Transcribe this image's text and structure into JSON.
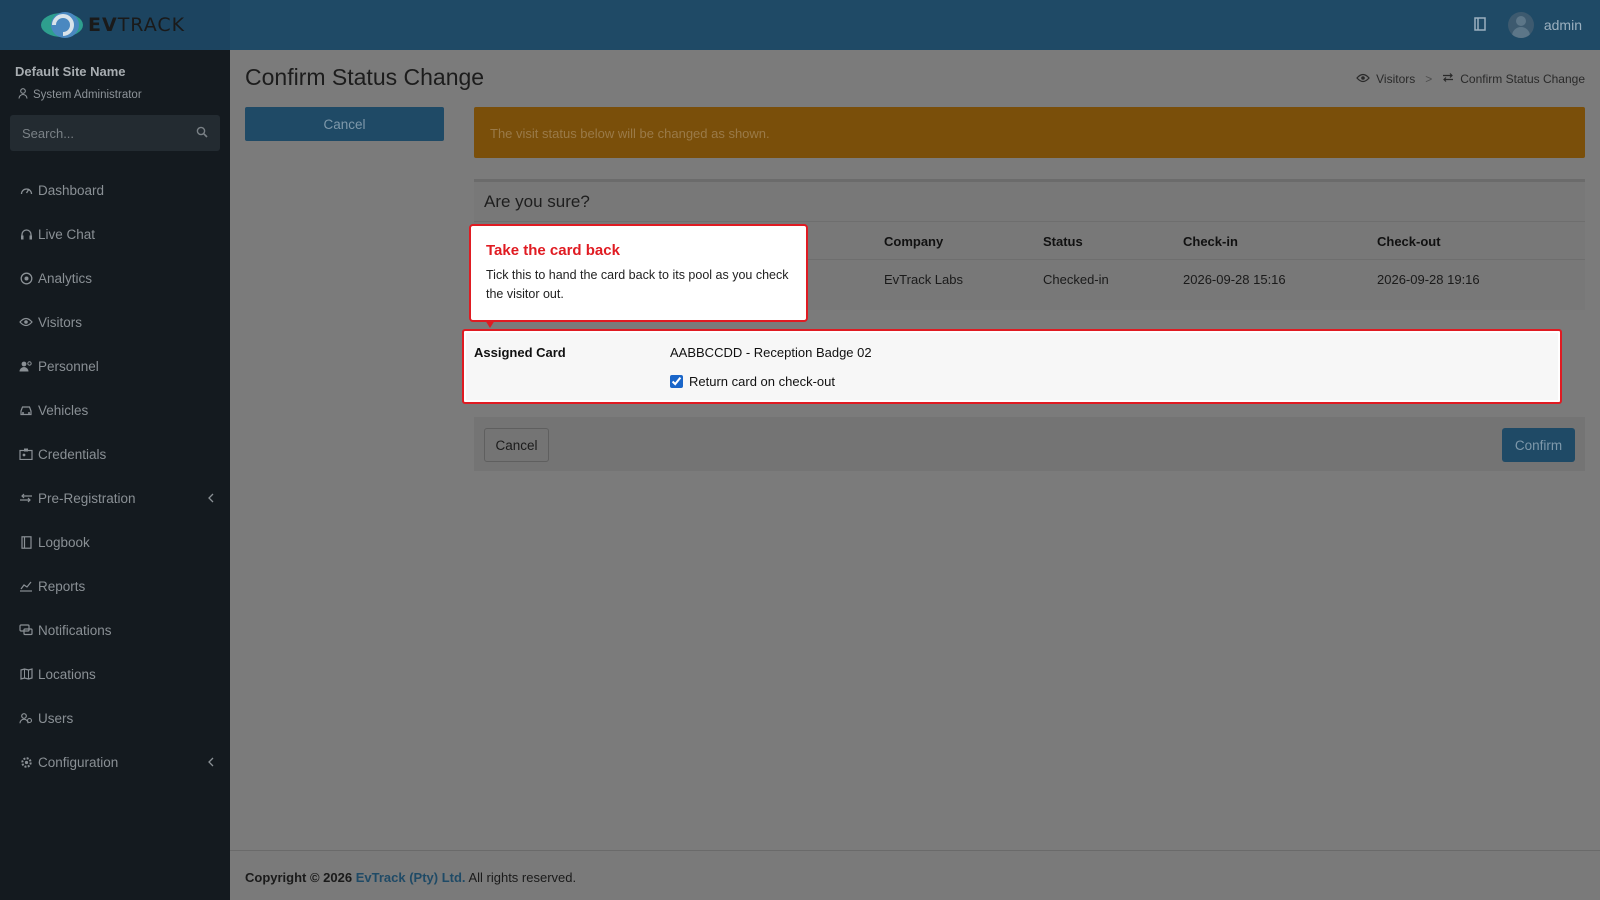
{
  "brand": {
    "name_bold": "EV",
    "name_rest": "TRACK"
  },
  "topbar": {
    "user_name": "admin"
  },
  "sidebar": {
    "site_name": "Default Site Name",
    "role": "System Administrator",
    "search_placeholder": "Search...",
    "items": [
      {
        "label": "Dashboard",
        "icon": "gauge-icon"
      },
      {
        "label": "Live Chat",
        "icon": "headset-icon"
      },
      {
        "label": "Analytics",
        "icon": "target-icon"
      },
      {
        "label": "Visitors",
        "icon": "eye-icon"
      },
      {
        "label": "Personnel",
        "icon": "user-group-icon"
      },
      {
        "label": "Vehicles",
        "icon": "car-icon"
      },
      {
        "label": "Credentials",
        "icon": "id-card-icon"
      },
      {
        "label": "Pre-Registration",
        "icon": "arrows-icon",
        "has_children": true
      },
      {
        "label": "Logbook",
        "icon": "book-icon"
      },
      {
        "label": "Reports",
        "icon": "chart-icon"
      },
      {
        "label": "Notifications",
        "icon": "chat-icon"
      },
      {
        "label": "Locations",
        "icon": "map-icon"
      },
      {
        "label": "Users",
        "icon": "users-icon"
      },
      {
        "label": "Configuration",
        "icon": "gear-icon",
        "has_children": true
      }
    ]
  },
  "page": {
    "title": "Confirm Status Change",
    "breadcrumb": {
      "parent": "Visitors",
      "current": "Confirm Status Change"
    },
    "side_cancel_label": "Cancel",
    "alert_text": "The visit status below will be changed as shown."
  },
  "confirm_box": {
    "header": "Are you sure?",
    "columns": [
      "Company",
      "Status",
      "Check-in",
      "Check-out"
    ],
    "row": {
      "company": "EvTrack Labs",
      "status": "Checked-in",
      "check_in": "2026-09-28 15:16",
      "check_out": "2026-09-28 19:16"
    }
  },
  "assigned_card": {
    "label": "Assigned Card",
    "value": "AABBCCDD - Reception Badge 02",
    "return_label": "Return card on check-out",
    "return_checked": true
  },
  "actions": {
    "cancel": "Cancel",
    "confirm": "Confirm"
  },
  "tooltip": {
    "title": "Take the card back",
    "body": "Tick this to hand the card back to its pool as you check the visitor out."
  },
  "footer": {
    "prefix": "Copyright © 2026",
    "company": "EvTrack (Pty) Ltd.",
    "suffix": "All rights reserved."
  },
  "colors": {
    "brand": "#1f4a66",
    "alert": "#7a4f0a",
    "highlight": "#e01b22"
  }
}
